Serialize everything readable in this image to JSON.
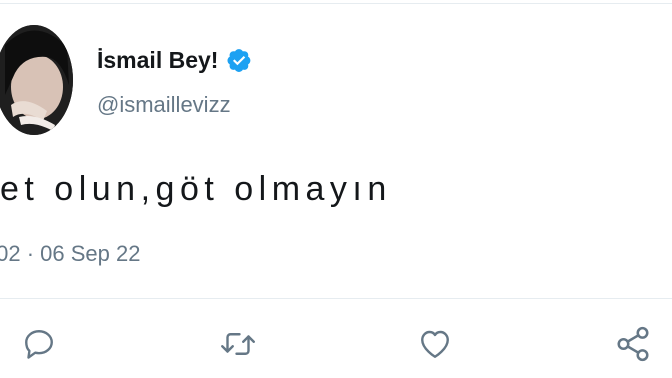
{
  "tweet": {
    "display_name": "İsmail Bey!",
    "handle": "@ismaillevizz",
    "text": "et olun,göt olmayın",
    "timestamp": ":02 · 06 Sep 22"
  },
  "icons": {
    "verified": "verified-badge-icon",
    "reply": "reply-icon",
    "retweet": "retweet-icon",
    "like": "heart-icon",
    "share": "share-icon"
  },
  "colors": {
    "verified": "#1da1f2",
    "icon": "#657786",
    "text": "#14171a",
    "secondary": "#657786"
  }
}
